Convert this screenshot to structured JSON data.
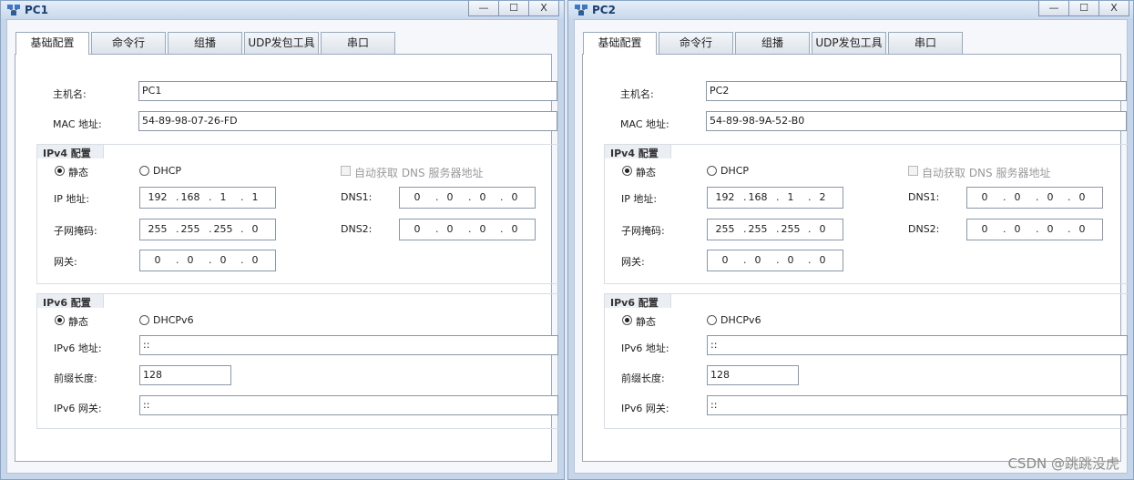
{
  "tabs": [
    "基础配置",
    "命令行",
    "组播",
    "UDP发包工具",
    "串口"
  ],
  "window_buttons": [
    "—",
    "☐",
    "X"
  ],
  "labels": {
    "hostname": "主机名:",
    "mac": "MAC 地址:",
    "ipv4_section": "IPv4 配置",
    "static": "静态",
    "dhcp": "DHCP",
    "auto_dns": "自动获取 DNS 服务器地址",
    "ip": "IP 地址:",
    "dns1": "DNS1:",
    "mask": "子网掩码:",
    "dns2": "DNS2:",
    "gateway": "网关:",
    "ipv6_section": "IPv6 配置",
    "dhcpv6": "DHCPv6",
    "ipv6_addr": "IPv6 地址:",
    "prefix": "前缀长度:",
    "ipv6_gw": "IPv6 网关:"
  },
  "windows": [
    {
      "title": "PC1",
      "hostname": "PC1",
      "mac": "54-89-98-07-26-FD",
      "ipv4_mode": "static",
      "ip": [
        "192",
        "168",
        "1",
        "1"
      ],
      "mask": [
        "255",
        "255",
        "255",
        "0"
      ],
      "gateway": [
        "0",
        "0",
        "0",
        "0"
      ],
      "dns1": [
        "0",
        "0",
        "0",
        "0"
      ],
      "dns2": [
        "0",
        "0",
        "0",
        "0"
      ],
      "ipv6_mode": "static",
      "ipv6_addr": "::",
      "prefix": "128",
      "ipv6_gw": "::"
    },
    {
      "title": "PC2",
      "hostname": "PC2",
      "mac": "54-89-98-9A-52-B0",
      "ipv4_mode": "static",
      "ip": [
        "192",
        "168",
        "1",
        "2"
      ],
      "mask": [
        "255",
        "255",
        "255",
        "0"
      ],
      "gateway": [
        "0",
        "0",
        "0",
        "0"
      ],
      "dns1": [
        "0",
        "0",
        "0",
        "0"
      ],
      "dns2": [
        "0",
        "0",
        "0",
        "0"
      ],
      "ipv6_mode": "static",
      "ipv6_addr": "::",
      "prefix": "128",
      "ipv6_gw": "::"
    }
  ],
  "watermark": "CSDN @跳跳没虎",
  "colors": {
    "title_text": "#1a3f72",
    "window_frame": "#c6d6ea"
  }
}
